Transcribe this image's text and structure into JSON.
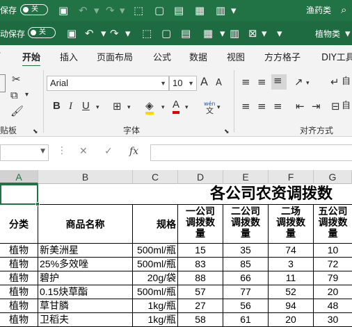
{
  "qat1": {
    "autosave_label": "保存",
    "toggle_state": "关",
    "workbook_name": "渔药类"
  },
  "qat2": {
    "autosave_label": "动保存",
    "toggle_state": "关",
    "workbook_name": "植物类"
  },
  "tabs": [
    "开始",
    "插入",
    "页面布局",
    "公式",
    "数据",
    "视图",
    "方方格子",
    "DIY工具"
  ],
  "tab_partial": "r",
  "ribbon": {
    "font_name": "Arial",
    "font_size": "10",
    "groups": {
      "clipboard": "贴板",
      "font": "字体",
      "alignment": "对齐方式"
    },
    "bold": "B",
    "italic": "I",
    "underline": "U",
    "grow_font": "A",
    "shrink_font": "A",
    "wen": "wén",
    "auto": "自"
  },
  "formula": {
    "fx": "fx",
    "cancel": "✕",
    "confirm": "✓"
  },
  "columns": [
    "A",
    "B",
    "C",
    "D",
    "E",
    "F",
    "G"
  ],
  "sheet": {
    "title": "各公司农资调拨数",
    "headers": {
      "category": "分类",
      "product": "商品名称",
      "spec": "规格",
      "d": [
        "一公司",
        "调拨数",
        "量"
      ],
      "e": [
        "二公司",
        "调拨数",
        "量"
      ],
      "f": [
        "二场",
        "调拨数",
        "量"
      ],
      "g": [
        "五公司",
        "调拨数",
        "量"
      ]
    },
    "rows": [
      {
        "cat": "植物",
        "name": "新美洲星",
        "spec": "500ml/瓶",
        "d": "15",
        "e": "35",
        "f": "74",
        "g": "10"
      },
      {
        "cat": "植物",
        "name": "25%多效唑",
        "spec": "500ml/瓶",
        "d": "83",
        "e": "85",
        "f": "3",
        "g": "72"
      },
      {
        "cat": "植物",
        "name": "碧护",
        "spec": "20g/袋",
        "d": "88",
        "e": "66",
        "f": "11",
        "g": "79"
      },
      {
        "cat": "植物",
        "name": "0.15炔草酯",
        "spec": "500ml/瓶",
        "d": "57",
        "e": "77",
        "f": "52",
        "g": "20"
      },
      {
        "cat": "植物",
        "name": "草甘膦",
        "spec": "1kg/瓶",
        "d": "27",
        "e": "56",
        "f": "94",
        "g": "48"
      },
      {
        "cat": "植物",
        "name": "卫稻夫",
        "spec": "1kg/瓶",
        "d": "58",
        "e": "61",
        "f": "20",
        "g": "30"
      }
    ]
  },
  "colors": {
    "excel_green": "#217346",
    "ribbon_bg": "#f3f3f3"
  }
}
